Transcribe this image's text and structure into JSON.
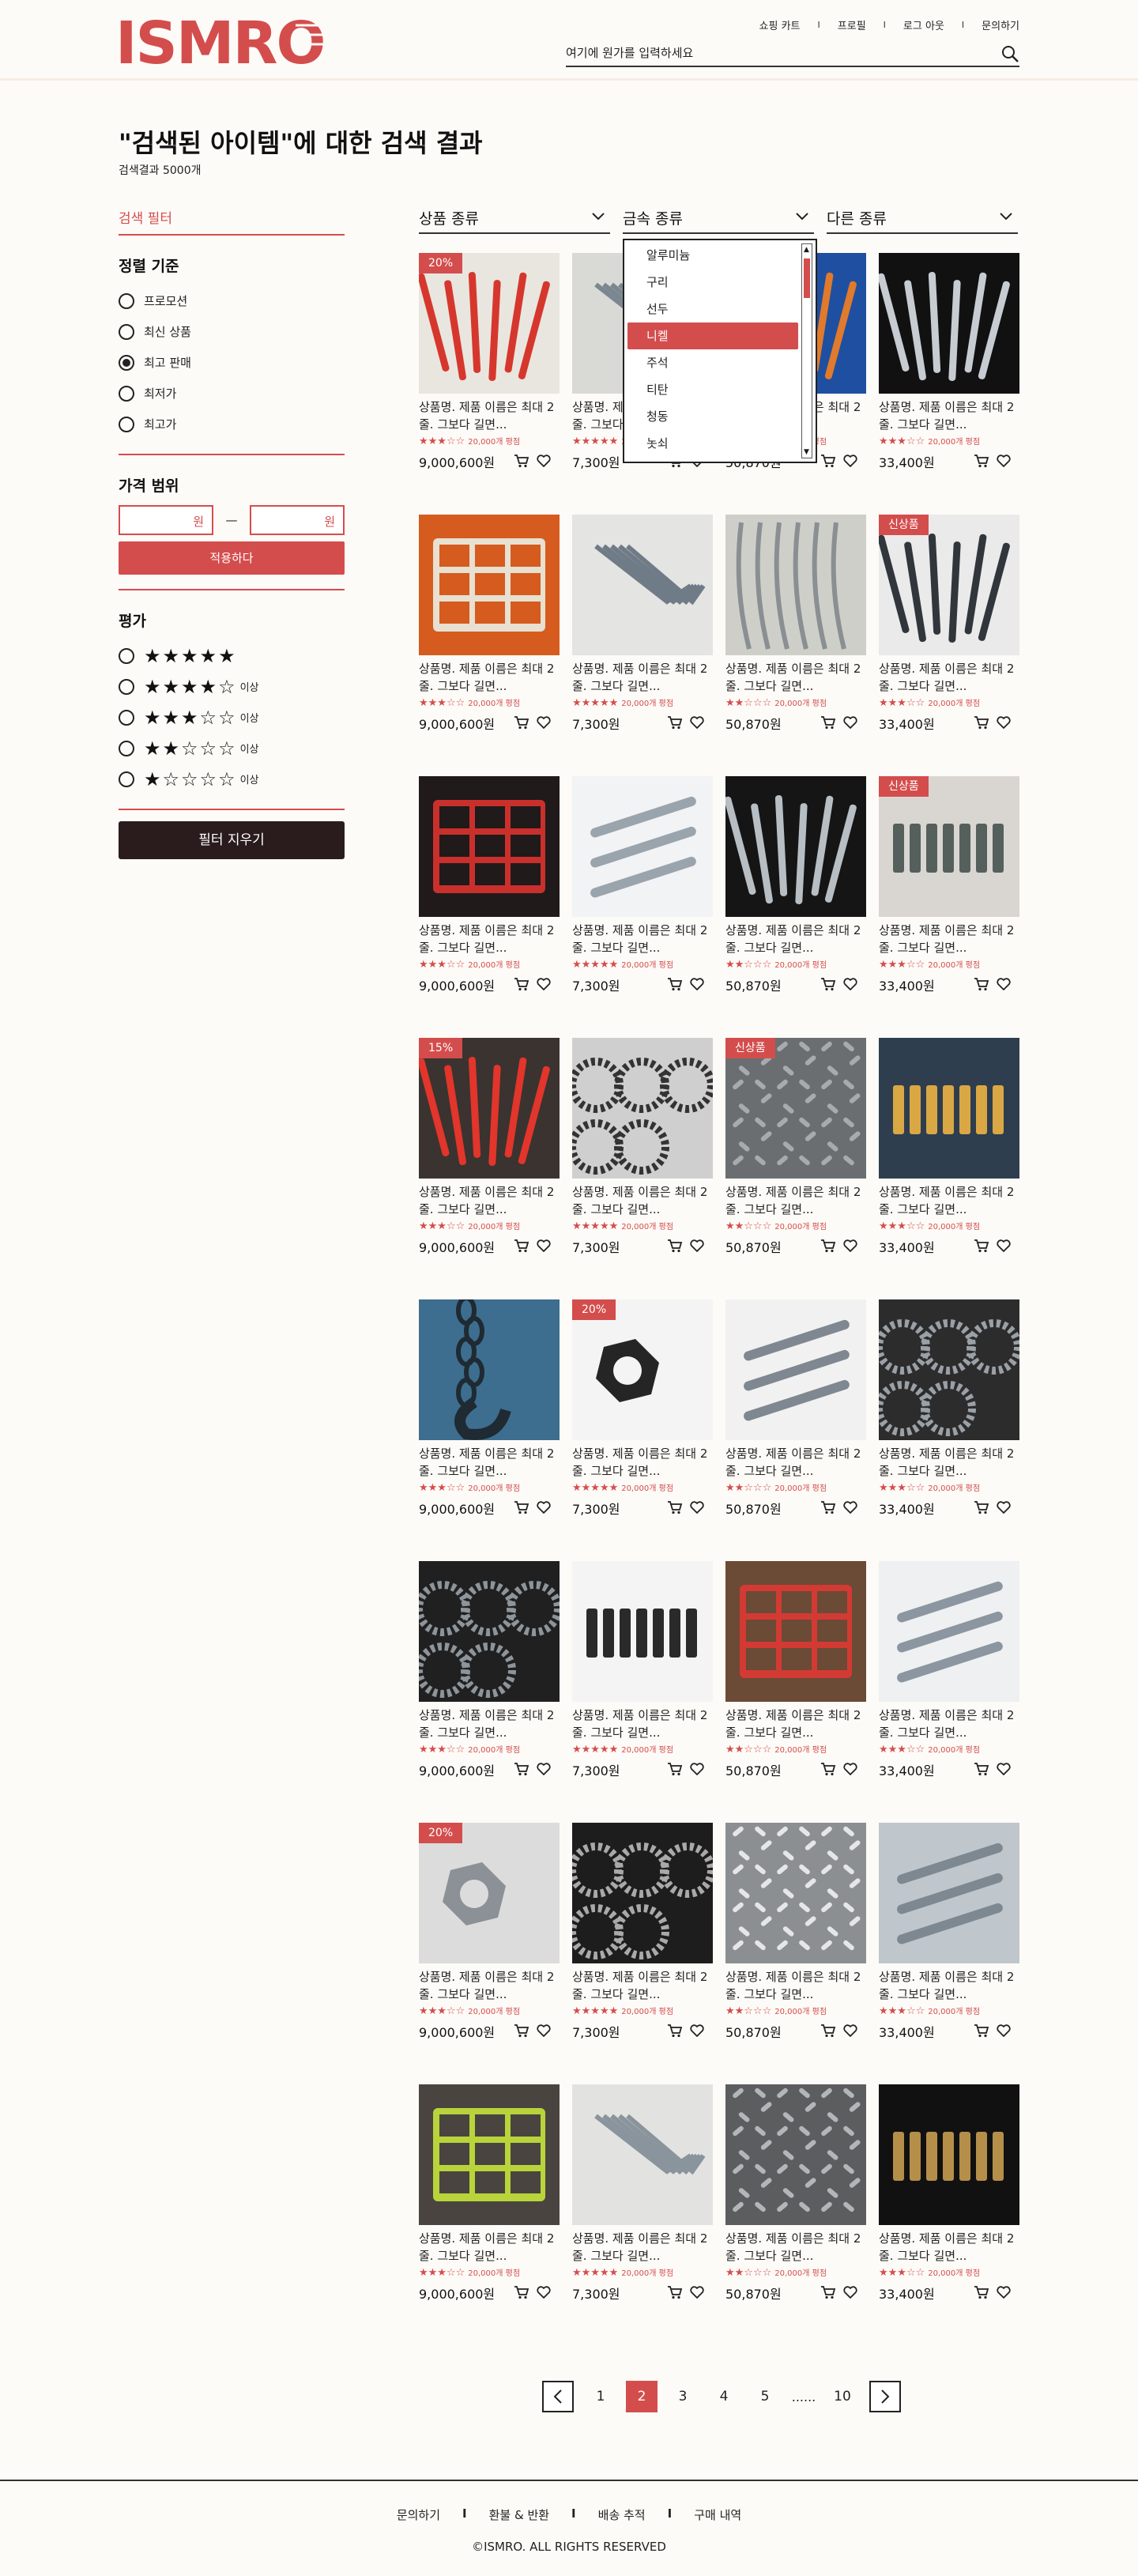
{
  "brand": {
    "logo_text": "ISMRO",
    "color": "#d44d4d"
  },
  "topnav": [
    "쇼핑 카트",
    "프로필",
    "로그 아웃",
    "문의하기"
  ],
  "search": {
    "placeholder": "여기에 원가를 입력하세요"
  },
  "page": {
    "title": "\"검색된 아이템\"에 대한 검색 결과",
    "count": "검색결과 5000개"
  },
  "sidebar": {
    "filter_title": "검색 필터",
    "sort_title": "정렬 기준",
    "sort_options": [
      "프로모션",
      "최신 상품",
      "최고 판매",
      "최저가",
      "최고가"
    ],
    "sort_selected": 2,
    "price_title": "가격 범위",
    "price_unit": "원",
    "price_dash": "—",
    "apply_label": "적용하다",
    "rating_title": "평가",
    "rating_options": [
      {
        "stars": "★★★★★",
        "suffix": ""
      },
      {
        "stars": "★★★★☆",
        "suffix": "이상"
      },
      {
        "stars": "★★★☆☆",
        "suffix": "이상"
      },
      {
        "stars": "★★☆☆☆",
        "suffix": "이상"
      },
      {
        "stars": "★☆☆☆☆",
        "suffix": "이상"
      }
    ],
    "clear_label": "필터 지우기"
  },
  "filters": {
    "product_type": "상품 종류",
    "metal_type": "금속 종류",
    "other_type": "다른 종류",
    "metal_options": [
      "알루미늄",
      "구리",
      "선두",
      "니켈",
      "주석",
      "티탄",
      "청동",
      "놋쇠"
    ],
    "metal_selected": 3
  },
  "products": {
    "name": "상품명. 제품 이름은 최대 2줄. 그보다 길면...",
    "review_text": "20,000개 평점",
    "prices": [
      "9,000,600원",
      "7,300원",
      "50,870원",
      "33,400원"
    ],
    "ratings": [
      "★★★☆☆",
      "★★★★★",
      "★★☆☆☆",
      "★★★☆☆"
    ],
    "badges": {
      "0": "20%",
      "7": "신상품",
      "11": "신상품",
      "12": "15%",
      "14": "신상품",
      "17": "20%",
      "24": "20%"
    }
  },
  "pagination": {
    "pages": [
      "1",
      "2",
      "3",
      "4",
      "5"
    ],
    "dots": "......",
    "last": "10",
    "active": "2"
  },
  "footer": {
    "links": [
      "문의하기",
      "환불 & 반환",
      "배송 추적",
      "구매 내역"
    ],
    "copyright": "©ISMRO. ALL RIGHTS RESERVED"
  }
}
